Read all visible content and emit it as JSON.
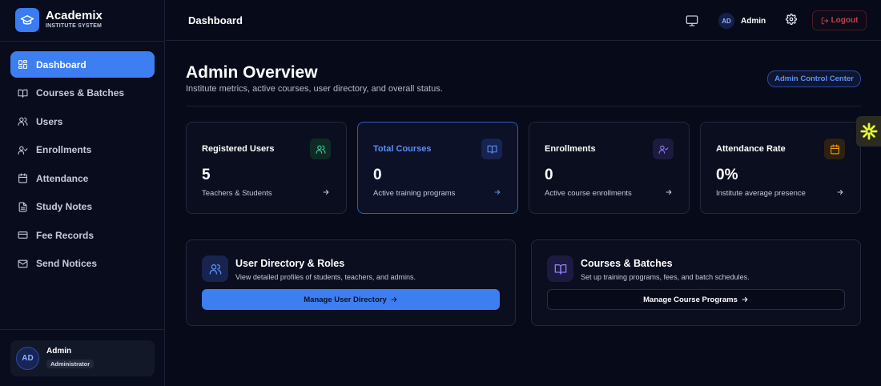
{
  "brand": {
    "name": "Academix",
    "subtitle": "INSTITUTE SYSTEM"
  },
  "sidebar": {
    "items": [
      {
        "label": "Dashboard",
        "icon": "grid-icon",
        "active": true
      },
      {
        "label": "Courses & Batches",
        "icon": "book-icon"
      },
      {
        "label": "Users",
        "icon": "users-icon"
      },
      {
        "label": "Enrollments",
        "icon": "user-check-icon"
      },
      {
        "label": "Attendance",
        "icon": "calendar-icon"
      },
      {
        "label": "Study Notes",
        "icon": "file-text-icon"
      },
      {
        "label": "Fee Records",
        "icon": "credit-card-icon"
      },
      {
        "label": "Send Notices",
        "icon": "mail-icon"
      }
    ],
    "user": {
      "initials": "AD",
      "name": "Admin",
      "role": "Administrator"
    }
  },
  "header": {
    "title": "Dashboard",
    "user_initials": "AD",
    "user_name": "Admin",
    "logout_label": "Logout"
  },
  "main": {
    "title": "Admin Overview",
    "subtitle": "Institute metrics, active courses, user directory, and overall status.",
    "badge": "Admin Control Center",
    "stats": [
      {
        "label": "Registered Users",
        "value": "5",
        "desc": "Teachers & Students",
        "icon": "users-icon",
        "accent": "#34d399"
      },
      {
        "label": "Total Courses",
        "value": "0",
        "desc": "Active training programs",
        "icon": "book-open-icon",
        "accent": "#5b8ff5"
      },
      {
        "label": "Enrollments",
        "value": "0",
        "desc": "Active course enrollments",
        "icon": "user-check-icon",
        "accent": "#8b7cf6"
      },
      {
        "label": "Attendance Rate",
        "value": "0%",
        "desc": "Institute average presence",
        "icon": "calendar-icon",
        "accent": "#f59e0b"
      }
    ],
    "actions": [
      {
        "title": "User Directory & Roles",
        "subtitle": "View detailed profiles of students, teachers, and admins.",
        "button": "Manage User Directory"
      },
      {
        "title": "Courses & Batches",
        "subtitle": "Set up training programs, fees, and batch schedules.",
        "button": "Manage Course Programs"
      }
    ]
  },
  "colors": {
    "accent": "#3d7ef1",
    "background": "#070a19",
    "danger": "#c0404f"
  }
}
